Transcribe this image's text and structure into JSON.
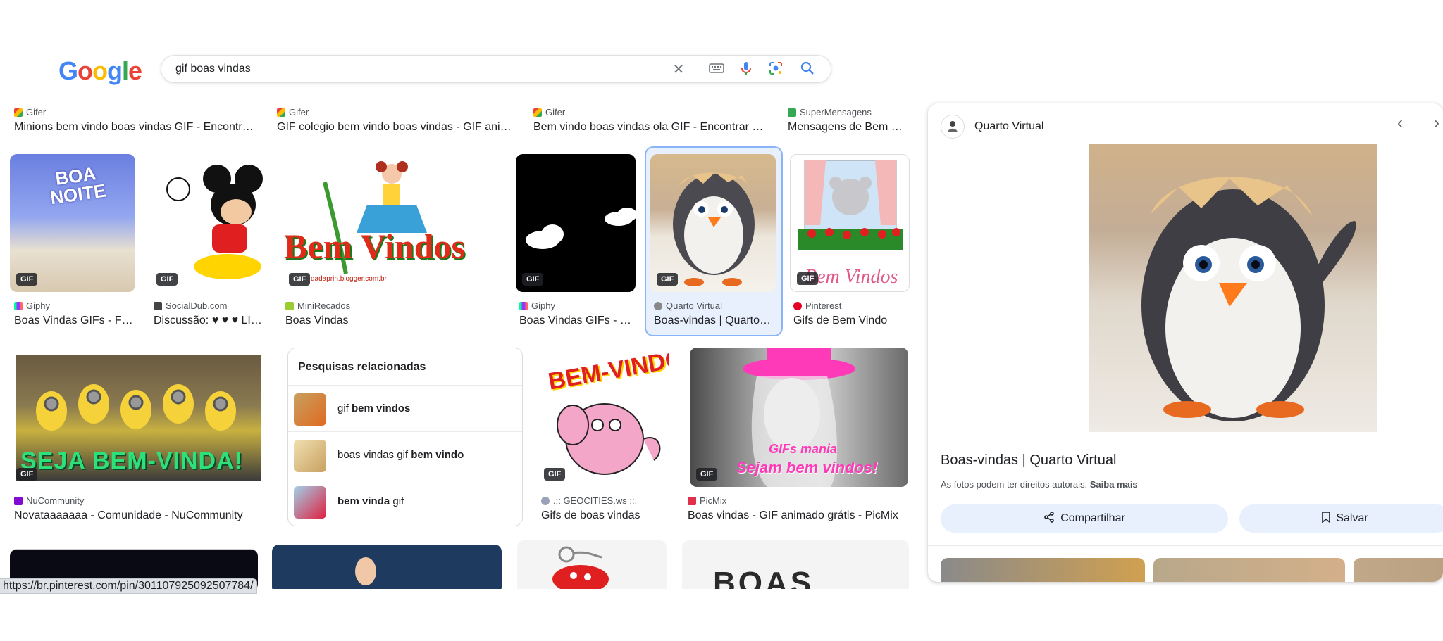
{
  "search": {
    "query": "gif boas vindas"
  },
  "top_row": [
    {
      "source": "Gifer",
      "title": "Minions bem vindo boas vindas GIF - Encontr…"
    },
    {
      "source": "Gifer",
      "title": "GIF colegio bem vindo boas vindas - GIF ani…"
    },
    {
      "source": "Gifer",
      "title": "Bem vindo boas vindas ola GIF - Encontrar …"
    },
    {
      "source": "SuperMensagens",
      "title": "Mensagens de Bem …"
    }
  ],
  "row2": [
    {
      "source": "Giphy",
      "title": "Boas Vindas GIFs - F…",
      "badge": "GIF",
      "caption": "BOA NOITE"
    },
    {
      "source": "SocialDub.com",
      "title": "Discussão: ♥ ♥ ♥ LI…",
      "badge": "GIF"
    },
    {
      "source": "MiniRecados",
      "title": "Boas Vindas",
      "badge": "GIF",
      "caption": "Bem Vindos",
      "watermark": "dadaprin.blogger.com.br"
    },
    {
      "source": "Giphy",
      "title": "Boas Vindas GIFs - …",
      "badge": "GIF"
    },
    {
      "source": "Quarto Virtual",
      "title": "Boas-vindas | Quarto…",
      "badge": "GIF"
    },
    {
      "source": "Pinterest",
      "title": "Gifs de Bem Vindo",
      "badge": "GIF",
      "caption": "Bem Vindos"
    }
  ],
  "row3": [
    {
      "source": "NuCommunity",
      "title": "Novataaaaaaa - Comunidade - NuCommunity",
      "badge": "GIF",
      "caption": "SEJA BEM-VINDA!"
    },
    {
      "source": ".:: GEOCITIES.ws ::.",
      "title": "Gifs de boas vindas",
      "badge": "GIF",
      "caption": "BEM-VINDO!"
    },
    {
      "source": "PicMix",
      "title": "Boas vindas - GIF animado grátis - PicMix",
      "badge": "GIF",
      "caption": "Sejam bem vindos!",
      "caption2": "GIFs mania"
    }
  ],
  "row4": {
    "caption": "BOAS"
  },
  "related": {
    "title": "Pesquisas relacionadas",
    "items": [
      {
        "plain": "gif ",
        "bold": "bem vindos",
        "tail": ""
      },
      {
        "plain": "boas vindas gif ",
        "bold": "bem vindo",
        "tail": ""
      },
      {
        "plain": "",
        "bold": "bem vinda",
        "tail": " gif"
      }
    ]
  },
  "status_url": "https://br.pinterest.com/pin/301107925092507784/",
  "panel": {
    "source": "Quarto Virtual",
    "title": "Boas-vindas | Quarto Virtual",
    "copyright": "As fotos podem ter direitos autorais.",
    "learn_more": "Saiba mais",
    "share": "Compartilhar",
    "save": "Salvar"
  },
  "colors": {
    "blue": "#4285f4",
    "red": "#ea4335",
    "yellow": "#fbbc05",
    "green": "#34a853",
    "selected_border": "#8ab4f8",
    "button_bg": "#e8f0fe"
  }
}
